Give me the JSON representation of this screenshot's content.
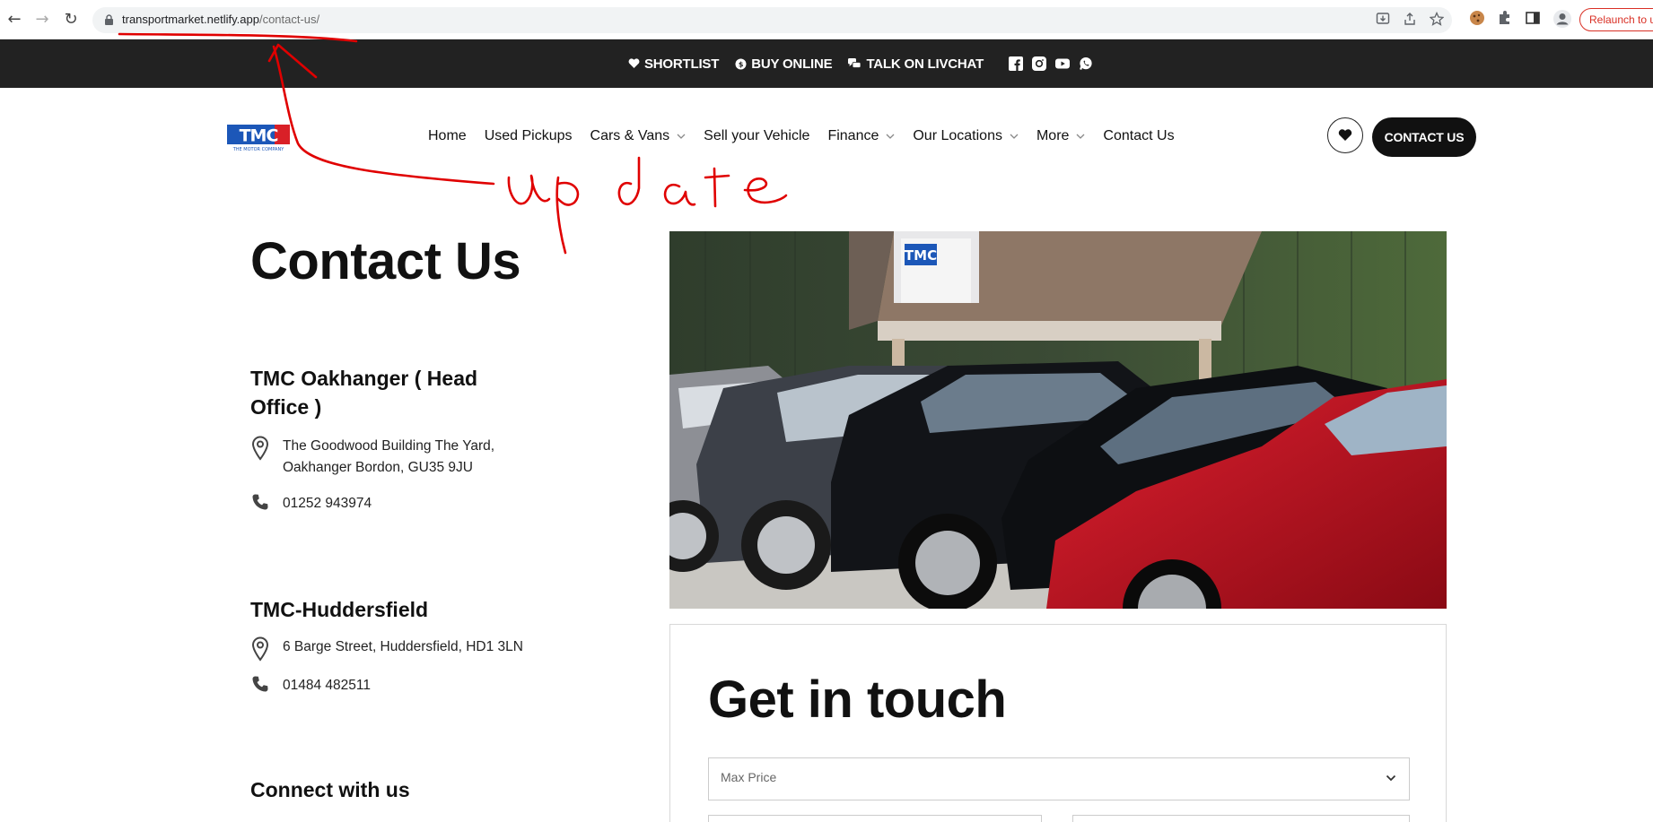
{
  "browser": {
    "url_host": "transportmarket.netlify.app",
    "url_path": "/contact-us/",
    "relaunch_label": "Relaunch to u"
  },
  "topbar": {
    "shortlist": "SHORTLIST",
    "buy_online": "BUY ONLINE",
    "livechat": "TALK ON LIVCHAT"
  },
  "logo": {
    "text": "TMC",
    "tagline": "THE MOTOR COMPANY"
  },
  "nav": {
    "items": [
      {
        "label": "Home",
        "dropdown": false
      },
      {
        "label": "Used Pickups",
        "dropdown": false
      },
      {
        "label": "Cars & Vans",
        "dropdown": true
      },
      {
        "label": "Sell your Vehicle",
        "dropdown": false
      },
      {
        "label": "Finance",
        "dropdown": true
      },
      {
        "label": "Our Locations",
        "dropdown": true
      },
      {
        "label": "More",
        "dropdown": true
      },
      {
        "label": "Contact Us",
        "dropdown": false
      }
    ],
    "contact_button": "CONTACT US"
  },
  "page": {
    "title": "Contact Us",
    "locations": [
      {
        "name": "TMC Oakhanger ( Head Office )",
        "address": "The Goodwood Building The Yard, Oakhanger Bordon, GU35 9JU",
        "phone": "01252 943974"
      },
      {
        "name": "TMC-Huddersfield",
        "address": "6 Barge Street, Huddersfield, HD1 3LN",
        "phone": "01484 482511"
      }
    ],
    "connect_heading": "Connect with us"
  },
  "form": {
    "heading": "Get in touch",
    "max_price_placeholder": "Max Price"
  },
  "photo": {
    "sign_text": "TMC"
  },
  "annotation": {
    "text": "update",
    "color": "#e00000"
  }
}
